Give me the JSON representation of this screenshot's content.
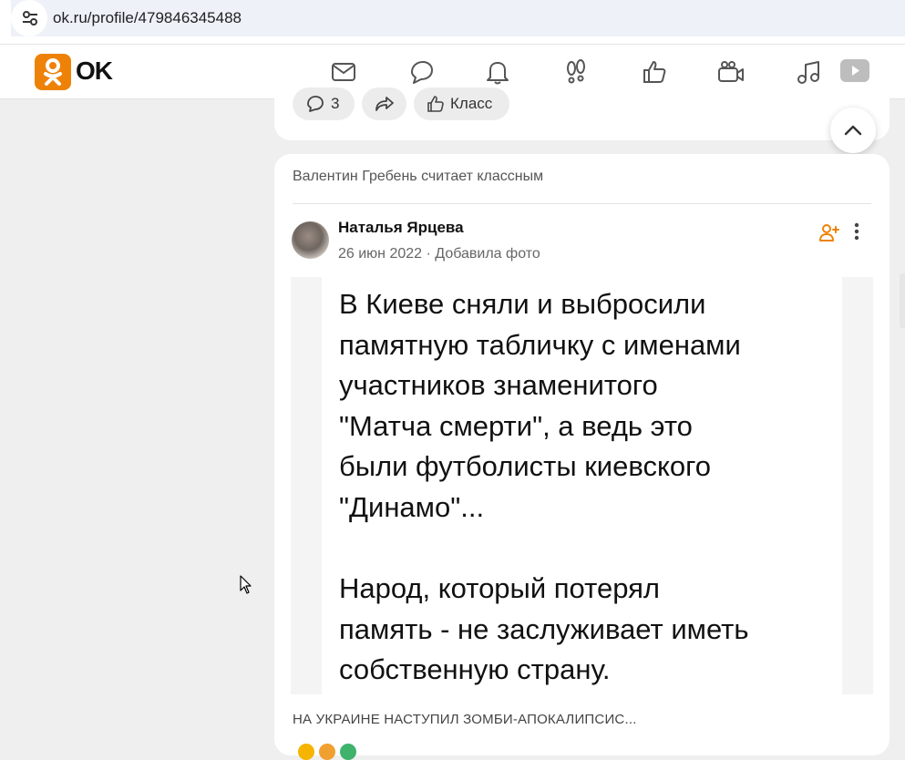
{
  "browser": {
    "url": "ok.ru/profile/479846345488",
    "site_info_icon": "tune-icon"
  },
  "header": {
    "logo_text": "OK",
    "brand_color": "#ee8208",
    "nav_icons": [
      "mail-icon",
      "chat-icon",
      "bell-icon",
      "footprints-icon",
      "like-icon",
      "video-camera-icon",
      "music-icon",
      "play-icon"
    ]
  },
  "prev_post": {
    "comments_count": "3",
    "like_label": "Класс"
  },
  "post": {
    "liked_by": "Валентин Гребень считает классным",
    "author": "Наталья Ярцева",
    "date": "26 июн 2022",
    "separator": "·",
    "action": "Добавила фото",
    "image_text": "В Киеве сняли и выбросили\nпамятную табличку с именами\nучастников знаменитого\n\"Матча смерти\", а ведь это\nбыли футболисты киевского\n\"Динамо\"...\n\nНарод, который потерял\nпамять - не заслуживает иметь\nсобственную страну.",
    "caption": "НА УКРАИНЕ НАСТУПИЛ ЗОМБИ-АПОКАЛИПСИС..."
  }
}
